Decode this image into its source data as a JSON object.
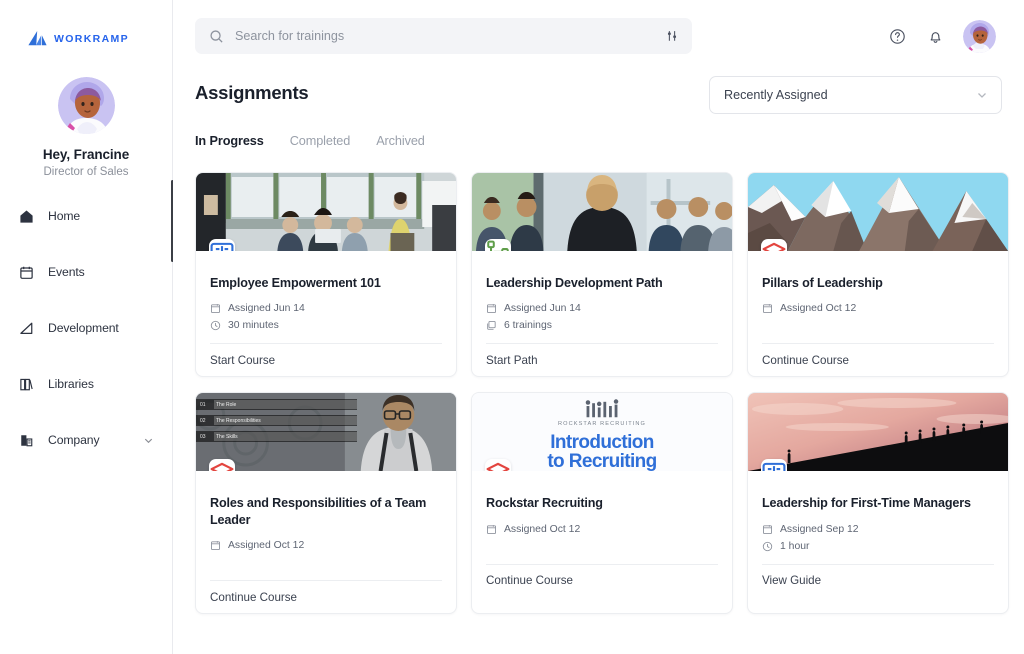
{
  "brand": {
    "name": "WORKRAMP",
    "color": "#2563eb",
    "logo_icon": "workramp-triangle-logo"
  },
  "sidebar": {
    "profile": {
      "greeting": "Hey, Francine",
      "role": "Director of Sales",
      "avatar_icon": "user-avatar"
    },
    "items": [
      {
        "label": "Home",
        "icon": "home-icon",
        "expandable": false
      },
      {
        "label": "Events",
        "icon": "calendar-icon",
        "expandable": false
      },
      {
        "label": "Development",
        "icon": "stairs-growth-icon",
        "expandable": false
      },
      {
        "label": "Libraries",
        "icon": "books-icon",
        "expandable": false
      },
      {
        "label": "Company",
        "icon": "building-icon",
        "expandable": true
      }
    ],
    "chevron_icon": "chevron-down-icon"
  },
  "topbar": {
    "search": {
      "placeholder": "Search for trainings",
      "value": "",
      "icon": "search-icon",
      "filter_icon": "filter-sliders-icon"
    },
    "help_icon": "help-circle-icon",
    "notifications_icon": "bell-icon",
    "avatar_icon": "user-avatar"
  },
  "page": {
    "title": "Assignments",
    "sort": {
      "selected": "Recently Assigned",
      "chevron_icon": "chevron-down-icon"
    },
    "tabs": [
      {
        "label": "In Progress",
        "active": true
      },
      {
        "label": "Completed",
        "active": false
      },
      {
        "label": "Archived",
        "active": false
      }
    ]
  },
  "cards": [
    {
      "title": "Employee Empowerment 101",
      "badge_icon": "book-open-icon",
      "badge_color": "#2f6fd8",
      "meta": [
        {
          "icon": "assigned-calendar-icon",
          "text": "Assigned Jun 14"
        },
        {
          "icon": "clock-icon",
          "text": "30 minutes"
        }
      ],
      "action": "Start Course",
      "thumb": "office-whiteboard-meeting"
    },
    {
      "title": "Leadership Development Path",
      "badge_icon": "path-nodes-icon",
      "badge_color": "#5f9e4a",
      "meta": [
        {
          "icon": "assigned-calendar-icon",
          "text": "Assigned Jun 14"
        },
        {
          "icon": "stack-icon",
          "text": "6 trainings"
        }
      ],
      "action": "Start Path",
      "thumb": "speaker-back-audience"
    },
    {
      "title": "Pillars of Leadership",
      "badge_icon": "graduation-cap-icon",
      "badge_color": "#e3453f",
      "meta": [
        {
          "icon": "assigned-calendar-icon",
          "text": "Assigned Oct 12"
        }
      ],
      "action": "Continue Course",
      "thumb": "lowpoly-mountains"
    },
    {
      "title": "Roles and Responsibilities of a Team Leader",
      "badge_icon": "graduation-cap-icon",
      "badge_color": "#e3453f",
      "meta": [
        {
          "icon": "assigned-calendar-icon",
          "text": "Assigned Oct 12"
        }
      ],
      "action": "Continue Course",
      "thumb": "man-glasses-gears",
      "thumb_rows": [
        {
          "num": "01",
          "text": "The Role"
        },
        {
          "num": "02",
          "text": "The Responsibilities"
        },
        {
          "num": "03",
          "text": "The Skills"
        }
      ]
    },
    {
      "title": "Rockstar Recruiting",
      "badge_icon": "graduation-cap-icon",
      "badge_color": "#e3453f",
      "meta": [
        {
          "icon": "assigned-calendar-icon",
          "text": "Assigned Oct 12"
        }
      ],
      "action": "Continue Course",
      "thumb": "rockstar-recruiting-title-slide",
      "thumb_eyebrow": "ROCKSTAR RECRUITING",
      "thumb_title_1": "Introduction",
      "thumb_title_2": "to Recruiting"
    },
    {
      "title": "Leadership for First-Time Managers",
      "badge_icon": "book-open-icon",
      "badge_color": "#2f6fd8",
      "meta": [
        {
          "icon": "assigned-calendar-icon",
          "text": "Assigned Sep 12"
        },
        {
          "icon": "clock-icon",
          "text": "1 hour"
        }
      ],
      "action": "View Guide",
      "thumb": "sunset-hikers-silhouette"
    }
  ]
}
